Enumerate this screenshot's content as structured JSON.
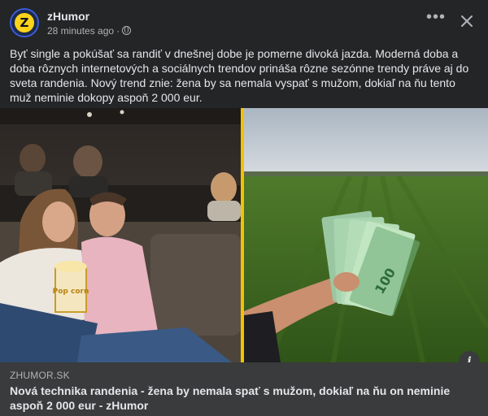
{
  "post": {
    "page_name": "zHumor",
    "avatar_letter": "Z",
    "timestamp": "28 minutes ago",
    "separator": "·",
    "text": "Byť single a pokúšať sa randiť v dnešnej dobe je pomerne divoká jazda. Moderná doba a doba rôznych internetových a sociálnych trendov prináša rôzne sezónne trendy práve aj do sveta randenia. Nový trend znie: žena by sa nemala vyspať s mužom, dokiaľ na ňu tento muž neminie dokopy aspoň 2 000 eur.",
    "icons": {
      "more": "more-options-icon",
      "close": "close-icon",
      "privacy": "globe-icon",
      "info": "info-icon"
    },
    "info_glyph": "i"
  },
  "media": {
    "left_scene": "couple in cinema eating popcorn",
    "right_scene": "hand holding euro banknotes over green field",
    "banknote_label": "100",
    "popcorn_text": "Pop corn",
    "divider_color": "#f2c200"
  },
  "link_preview": {
    "domain": "ZHUMOR.SK",
    "title": "Nová technika randenia - žena by nemala spať s mužom, dokiaľ na ňu on neminie aspoň 2 000 eur - zHumor"
  },
  "colors": {
    "background": "#242526",
    "text_primary": "#e4e6eb",
    "text_secondary": "#b0b3b8",
    "link_box": "#3a3b3c",
    "brand_yellow": "#ffd31a"
  }
}
